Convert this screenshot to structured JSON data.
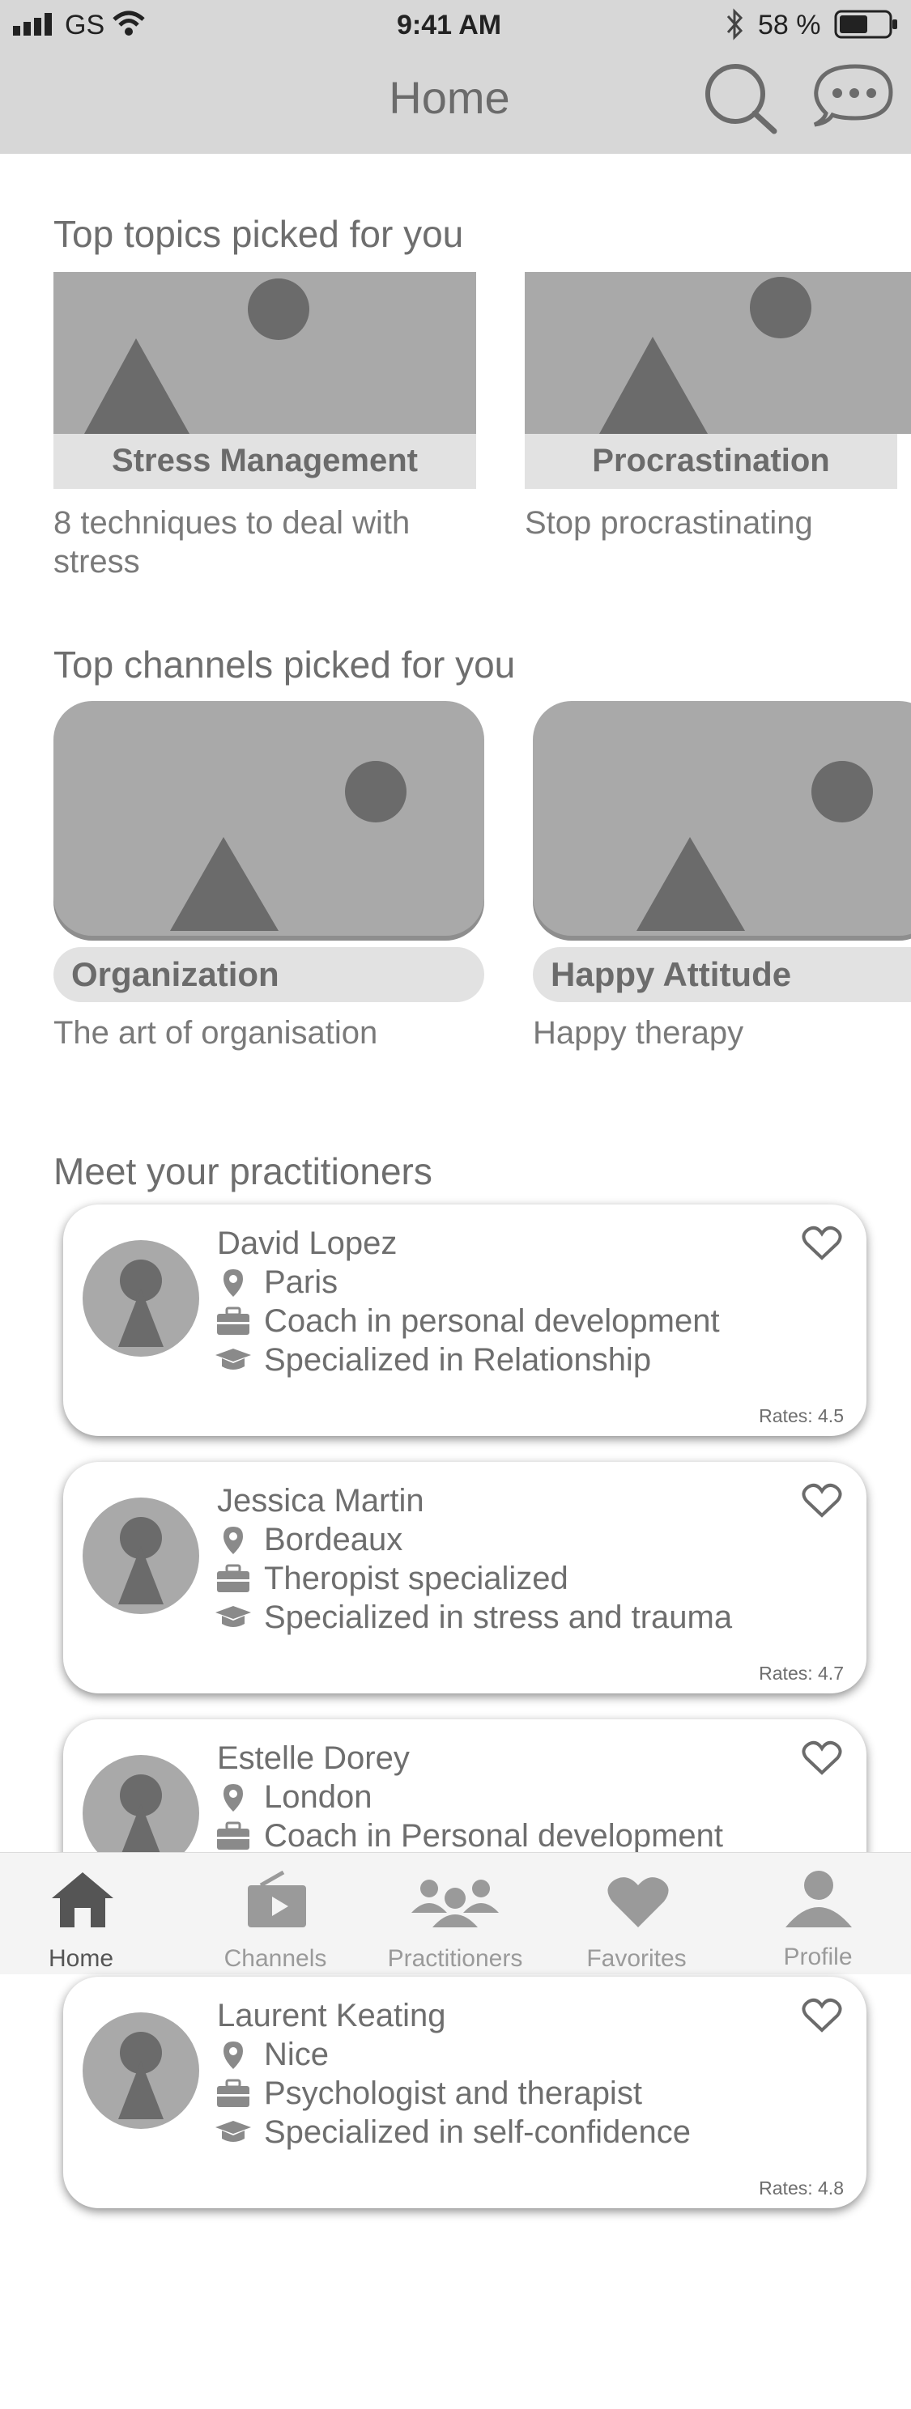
{
  "status_bar": {
    "carrier": "GS",
    "time": "9:41 AM",
    "battery": "58 %"
  },
  "header": {
    "title": "Home",
    "search_icon": "search-icon",
    "chat_icon": "chat-bubble-icon"
  },
  "topics": {
    "heading": "Top topics picked for you",
    "items": [
      {
        "label": "Stress Management",
        "description": "8 techniques to deal with stress"
      },
      {
        "label": "Procrastination",
        "description": "Stop procrastinating"
      }
    ]
  },
  "channels": {
    "heading": "Top channels picked for you",
    "items": [
      {
        "label": "Organization",
        "description": "The art of organisation"
      },
      {
        "label": "Happy Attitude",
        "description": "Happy therapy"
      }
    ]
  },
  "practitioners": {
    "heading": "Meet your practitioners",
    "items": [
      {
        "name": "David Lopez",
        "city": "Paris",
        "job": "Coach in personal development",
        "specialty": "Specialized in Relationship",
        "rating": "Rates: 4.5"
      },
      {
        "name": "Jessica Martin",
        "city": "Bordeaux",
        "job": "Theropist specialized",
        "specialty": "Specialized in stress and trauma",
        "rating": "Rates: 4.7"
      },
      {
        "name": "Estelle Dorey",
        "city": "London",
        "job": "Coach in Personal development",
        "specialty": "",
        "rating": ""
      },
      {
        "name": "Laurent Keating",
        "city": "Nice",
        "job": "Psychologist and therapist",
        "specialty": "Specialized in self-confidence",
        "rating": "Rates: 4.8"
      }
    ]
  },
  "tabbar": {
    "items": [
      {
        "label": "Home",
        "icon": "home-icon",
        "active": true
      },
      {
        "label": "Channels",
        "icon": "channels-icon",
        "active": false
      },
      {
        "label": "Practitioners",
        "icon": "practitioners-icon",
        "active": false
      },
      {
        "label": "Favorites",
        "icon": "heart-icon",
        "active": false
      },
      {
        "label": "Profile",
        "icon": "profile-icon",
        "active": false
      }
    ]
  },
  "colors": {
    "header_bg": "#d7d7d7",
    "placeholder": "#a9a9a9",
    "shape": "#6b6b6b",
    "label_bg": "#e2e2e2",
    "active_tab": "#555555",
    "inactive_tab": "#9a9a9a"
  }
}
